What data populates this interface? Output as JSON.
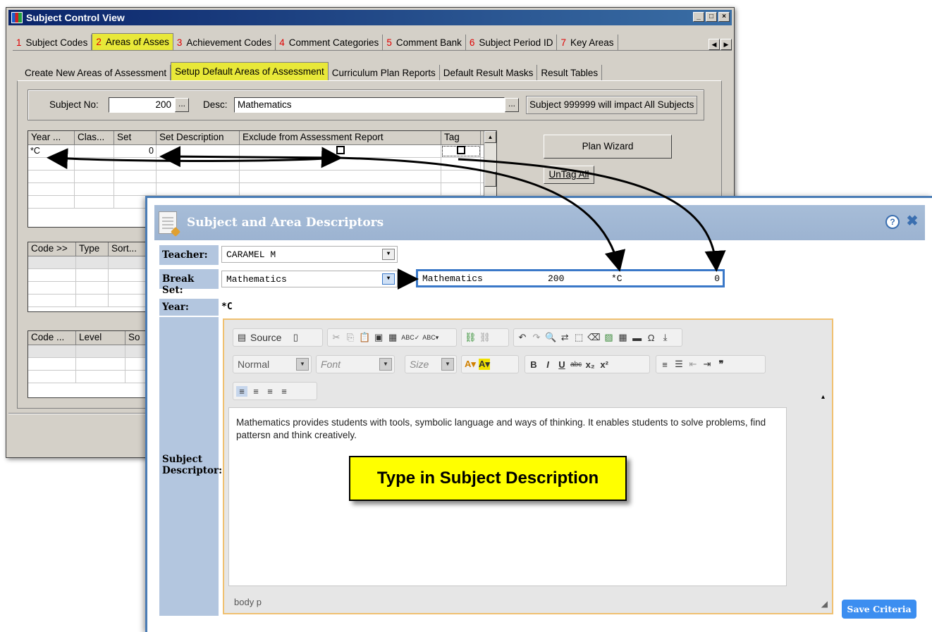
{
  "window": {
    "title": "Subject Control View",
    "controls": [
      "_",
      "□",
      "×"
    ]
  },
  "main_tabs": [
    {
      "num": "1",
      "label": "Subject Codes"
    },
    {
      "num": "2",
      "label": "Areas of Asses"
    },
    {
      "num": "3",
      "label": "Achievement Codes"
    },
    {
      "num": "4",
      "label": "Comment Categories"
    },
    {
      "num": "5",
      "label": "Comment Bank"
    },
    {
      "num": "6",
      "label": "Subject Period ID"
    },
    {
      "num": "7",
      "label": "Key Areas"
    }
  ],
  "sub_tabs": [
    "Create New Areas of Assessment",
    "Setup Default Areas of Assessment",
    "Curriculum Plan Reports",
    "Default Result Masks",
    "Result Tables"
  ],
  "subject": {
    "no_label": "Subject No:",
    "no_value": "200",
    "desc_label": "Desc:",
    "desc_value": "Mathematics",
    "note": "Subject 999999 will impact All Subjects",
    "ellipsis": "..."
  },
  "grid1": {
    "headers": [
      "Year ...",
      "Clas...",
      "Set",
      "Set Description",
      "Exclude from Assessment Report",
      "Tag"
    ],
    "row": {
      "year": "*C",
      "set": "0"
    }
  },
  "grid2": {
    "headers": [
      "Code >>",
      "Type",
      "Sort..."
    ]
  },
  "grid3": {
    "headers": [
      "Code ...",
      "Level",
      "So"
    ]
  },
  "buttons": {
    "plan_wizard": "Plan Wizard",
    "untag_all": "UnTag All"
  },
  "dialog": {
    "title": "Subject and Area Descriptors",
    "teacher_label": "Teacher:",
    "teacher_value": "CARAMEL M",
    "breakset_label": "Break Set:",
    "breakset_value": "Mathematics",
    "info": {
      "desc": "Mathematics",
      "subject": "200",
      "year": "*C",
      "set": "0"
    },
    "year_label": "Year:",
    "year_value": "*C",
    "descriptor_label_1": "Subject",
    "descriptor_label_2": "Descriptor:",
    "save_label": "Save Criteria"
  },
  "editor": {
    "source_label": "Source",
    "format_value": "Normal",
    "font_placeholder": "Font",
    "size_placeholder": "Size",
    "text": "Mathematics provides students with tools, symbolic language and ways of thinking. It enables students to solve problems, find pattersn and think creatively.",
    "path": "body  p"
  },
  "callout": "Type in Subject Description",
  "colors": {
    "highlight_tab": "#e8e839",
    "dialog_border": "#4a7cb5",
    "label_bg": "#b3c6df",
    "save_button": "#3c8ef0",
    "callout_bg": "#ffff00"
  }
}
